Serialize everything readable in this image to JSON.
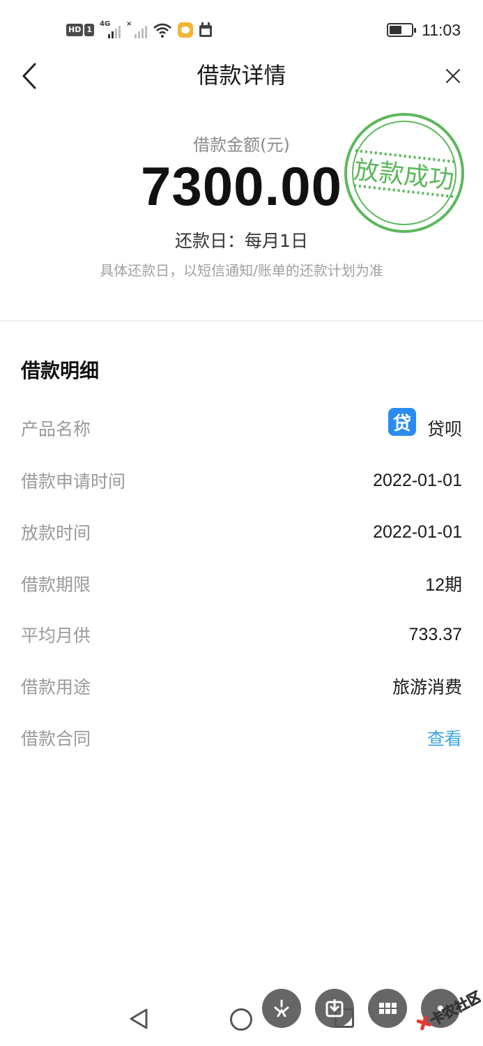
{
  "status_bar": {
    "hd_label": "HD",
    "sim_label": "1",
    "net_label": "4G",
    "time": "11:03",
    "battery_level": 0.55
  },
  "nav": {
    "title": "借款详情"
  },
  "summary": {
    "amount_label": "借款金额(元)",
    "amount": "7300.00",
    "repay_day": "还款日：每月1日",
    "repay_note": "具体还款日，以短信通知/账单的还款计划为准",
    "stamp_text": "放款成功",
    "stamp_color": "#5cb85c"
  },
  "details": {
    "section_title": "借款明细",
    "rows": [
      {
        "label": "产品名称",
        "value": "贷呗",
        "icon": "贷"
      },
      {
        "label": "借款申请时间",
        "value": "2022-01-01"
      },
      {
        "label": "放款时间",
        "value": "2022-01-01"
      },
      {
        "label": "借款期限",
        "value": "12期"
      },
      {
        "label": "平均月供",
        "value": "733.37"
      },
      {
        "label": "借款用途",
        "value": "旅游消费"
      },
      {
        "label": "借款合同",
        "value": "查看"
      }
    ]
  },
  "bottom": {
    "fab_icons": [
      "share-icon",
      "download-icon",
      "grid-icon",
      "more-icon"
    ],
    "watermark_text": "卡农社区"
  }
}
